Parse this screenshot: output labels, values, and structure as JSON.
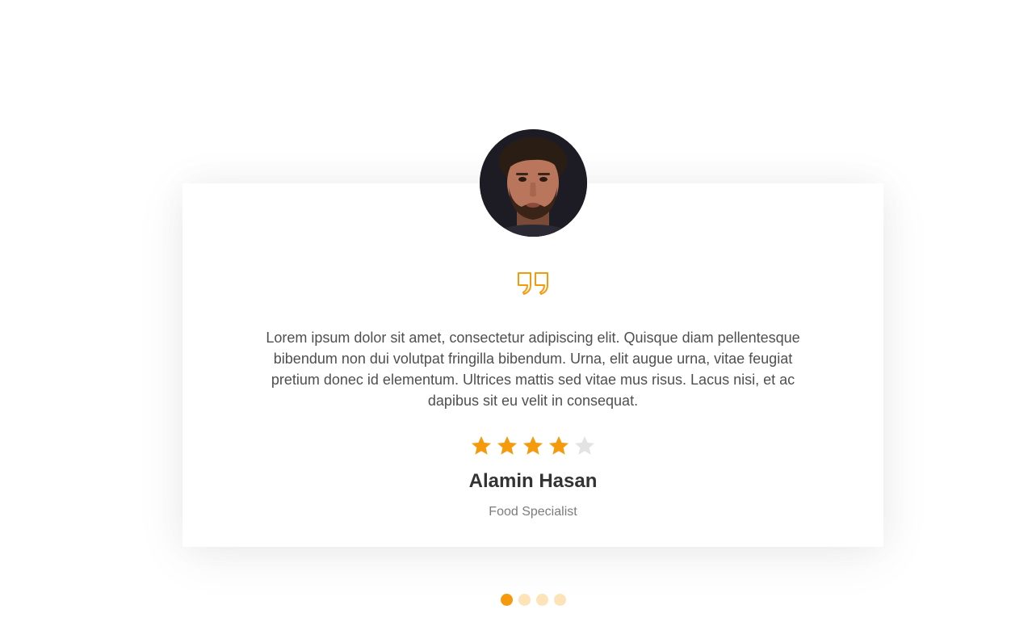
{
  "testimonial": {
    "quote_icon": "quote-icon",
    "text": "Lorem ipsum dolor sit amet, consectetur adipiscing elit. Quisque diam pellentesque bibendum non dui volutpat fringilla bibendum. Urna, elit augue urna, vitae feugiat pretium donec id elementum. Ultrices mattis sed vitae mus risus. Lacus nisi, et ac dapibus sit eu velit in consequat.",
    "rating": 4,
    "rating_max": 5,
    "name": "Alamin Hasan",
    "role": "Food Specialist"
  },
  "slider": {
    "slide_count": 4,
    "active_index": 0
  },
  "colors": {
    "accent": "#f69a0d",
    "star_empty": "#e3e3e3",
    "dot_inactive": "#fde3b8",
    "text": "#4f4f4f",
    "name": "#333333",
    "role": "#7c7c7c"
  }
}
